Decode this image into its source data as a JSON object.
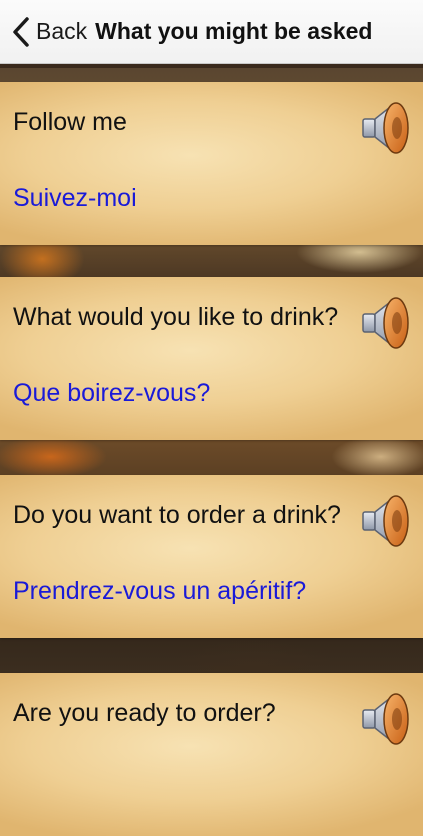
{
  "nav": {
    "back_label": "Back",
    "title": "What you might be asked"
  },
  "phrases": [
    {
      "english": "Follow me",
      "french": "Suivez-moi"
    },
    {
      "english": "What would you like to drink?",
      "french": "Que boirez-vous?"
    },
    {
      "english": "Do you want to order a drink?",
      "french": "Prendrez-vous un apéritif?"
    },
    {
      "english": "Are you ready to order?",
      "french": ""
    }
  ],
  "colors": {
    "french_text": "#1a1ad8",
    "parchment": "#efcf93",
    "speaker_orange": "#e8842c"
  },
  "icons": {
    "back": "chevron-left-icon",
    "play": "speaker-icon"
  }
}
